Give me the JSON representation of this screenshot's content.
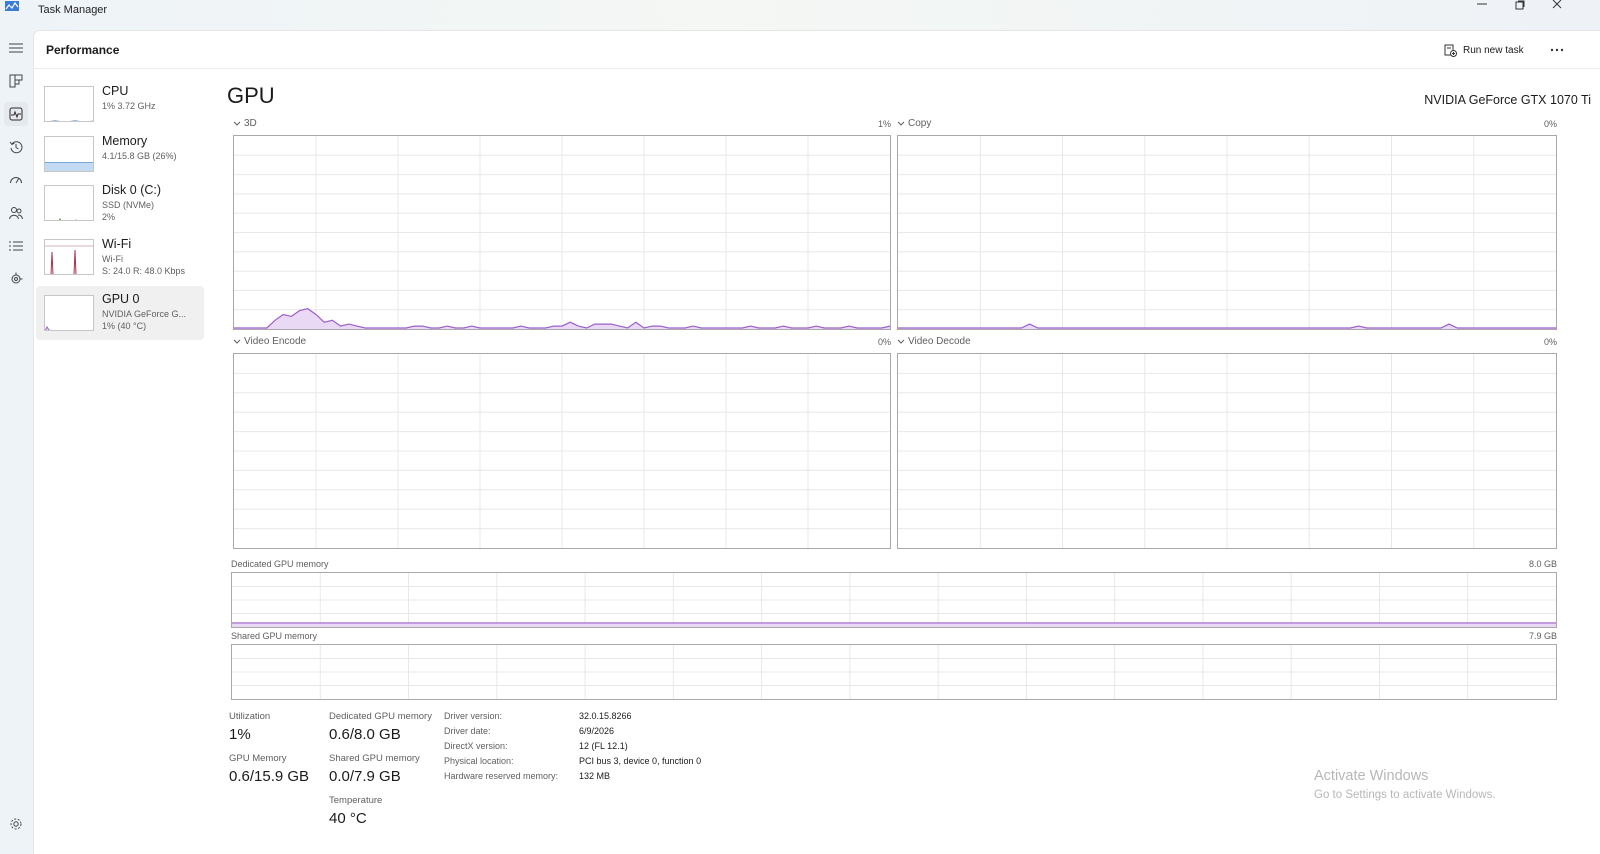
{
  "window": {
    "title": "Task Manager"
  },
  "header": {
    "title": "Performance",
    "run_new_task": "Run new task"
  },
  "sidebar": {
    "items": [
      {
        "name": "CPU",
        "line1": "1% 3.72 GHz",
        "line2": ""
      },
      {
        "name": "Memory",
        "line1": "4.1/15.8 GB (26%)",
        "line2": ""
      },
      {
        "name": "Disk 0 (C:)",
        "line1": "SSD (NVMe)",
        "line2": "2%"
      },
      {
        "name": "Wi-Fi",
        "line1": "Wi-Fi",
        "line2": "S: 24.0  R: 48.0 Kbps"
      },
      {
        "name": "GPU 0",
        "line1": "NVIDIA GeForce G...",
        "line2": "1% (40 °C)"
      }
    ],
    "memory_fill": 0.26,
    "active_index": 4
  },
  "gpu": {
    "title": "GPU",
    "model": "NVIDIA GeForce GTX 1070 Ti",
    "engines": [
      {
        "label": "3D",
        "percent": "1%"
      },
      {
        "label": "Copy",
        "percent": "0%"
      },
      {
        "label": "Video Encode",
        "percent": "0%"
      },
      {
        "label": "Video Decode",
        "percent": "0%"
      }
    ],
    "dedicated_memory": {
      "label": "Dedicated GPU memory",
      "max": "8.0 GB"
    },
    "shared_memory": {
      "label": "Shared GPU memory",
      "max": "7.9 GB"
    }
  },
  "stats": {
    "utilization_label": "Utilization",
    "utilization": "1%",
    "dedicated_label": "Dedicated GPU memory",
    "dedicated": "0.6/8.0 GB",
    "gpu_memory_label": "GPU Memory",
    "gpu_memory": "0.6/15.9 GB",
    "shared_label": "Shared GPU memory",
    "shared": "0.0/7.9 GB",
    "temperature_label": "Temperature",
    "temperature": "40 °C"
  },
  "driver": {
    "version_label": "Driver version:",
    "version": "32.0.15.8266",
    "date_label": "Driver date:",
    "date": "6/9/2026",
    "directx_label": "DirectX version:",
    "directx": "12 (FL 12.1)",
    "location_label": "Physical location:",
    "location": "PCI bus 3, device 0, function 0",
    "reserved_label": "Hardware reserved memory:",
    "reserved": "132 MB"
  },
  "watermark": {
    "title": "Activate Windows",
    "subtitle": "Go to Settings to activate Windows."
  },
  "colors": {
    "gpu_line": "#9a5fc9",
    "gpu_fill": "#ead9f5",
    "wifi_line": "#a83250",
    "memory_fill": "#c2dbf2",
    "grid": "#e8e8e8"
  },
  "series": {
    "d3": [
      0,
      0,
      0,
      0,
      0,
      4,
      7,
      6,
      9,
      10,
      7,
      3,
      4,
      1,
      2,
      1,
      0,
      0,
      0,
      0,
      0,
      0,
      1,
      1,
      0,
      0,
      1,
      0,
      0,
      1,
      0,
      0,
      0,
      0,
      0,
      1,
      0,
      0,
      0,
      1,
      1,
      3,
      1,
      0,
      2,
      2,
      2,
      1,
      0,
      3,
      0,
      1,
      1,
      0,
      0,
      0,
      1,
      0,
      0,
      0,
      0,
      0,
      0,
      1,
      0,
      0,
      0,
      1,
      0,
      0,
      0,
      1,
      0,
      0,
      0,
      1,
      0,
      0,
      0,
      0,
      1
    ],
    "copy": [
      0,
      0,
      0,
      0,
      0,
      0,
      0,
      0,
      0,
      0,
      0,
      0,
      0,
      0,
      0,
      0,
      2,
      0,
      0,
      0,
      0,
      0,
      0,
      0,
      0,
      0,
      0,
      0,
      0,
      0,
      0,
      0,
      0,
      0,
      0,
      0,
      0,
      0,
      0,
      0,
      0,
      0,
      0,
      0,
      0,
      0,
      0,
      0,
      0,
      0,
      0,
      0,
      0,
      0,
      0,
      0,
      1,
      0,
      0,
      0,
      0,
      0,
      0,
      0,
      0,
      0,
      0,
      2,
      0,
      0,
      0,
      0,
      0,
      0,
      0,
      0,
      0,
      0,
      0,
      0,
      0
    ]
  }
}
